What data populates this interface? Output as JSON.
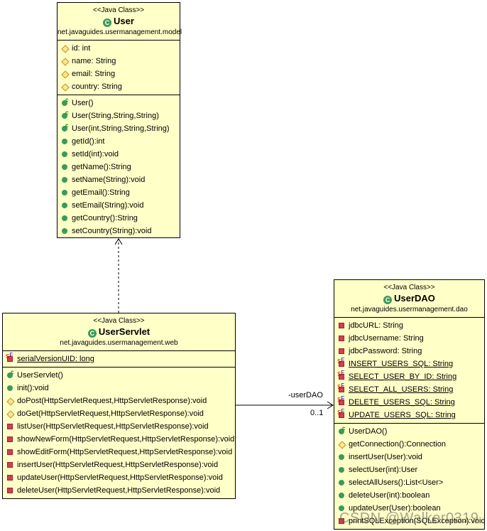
{
  "classes": {
    "user": {
      "stereotype": "<<Java Class>>",
      "name": "User",
      "package": "net.javaguides.usermanagement.model",
      "fields": [
        {
          "v": "protected",
          "t": "id: int"
        },
        {
          "v": "protected",
          "t": "name: String"
        },
        {
          "v": "protected",
          "t": "email: String"
        },
        {
          "v": "protected",
          "t": "country: String"
        }
      ],
      "methods": [
        {
          "v": "public",
          "c": true,
          "t": "User()"
        },
        {
          "v": "public",
          "c": true,
          "t": "User(String,String,String)"
        },
        {
          "v": "public",
          "c": true,
          "t": "User(int,String,String,String)"
        },
        {
          "v": "public",
          "t": "getId():int"
        },
        {
          "v": "public",
          "t": "setId(int):void"
        },
        {
          "v": "public",
          "t": "getName():String"
        },
        {
          "v": "public",
          "t": "setName(String):void"
        },
        {
          "v": "public",
          "t": "getEmail():String"
        },
        {
          "v": "public",
          "t": "setEmail(String):void"
        },
        {
          "v": "public",
          "t": "getCountry():String"
        },
        {
          "v": "public",
          "t": "setCountry(String):void"
        }
      ]
    },
    "servlet": {
      "stereotype": "<<Java Class>>",
      "name": "UserServlet",
      "package": "net.javaguides.usermanagement.web",
      "fields": [
        {
          "v": "private",
          "sf": true,
          "t": "serialVersionUID: long"
        }
      ],
      "methods": [
        {
          "v": "public",
          "c": true,
          "t": "UserServlet()"
        },
        {
          "v": "public",
          "t": "init():void"
        },
        {
          "v": "protected",
          "t": "doPost(HttpServletRequest,HttpServletResponse):void"
        },
        {
          "v": "protected",
          "t": "doGet(HttpServletRequest,HttpServletResponse):void"
        },
        {
          "v": "private",
          "t": "listUser(HttpServletRequest,HttpServletResponse):void"
        },
        {
          "v": "private",
          "t": "showNewForm(HttpServletRequest,HttpServletResponse):void"
        },
        {
          "v": "private",
          "t": "showEditForm(HttpServletRequest,HttpServletResponse):void"
        },
        {
          "v": "private",
          "t": "insertUser(HttpServletRequest,HttpServletResponse):void"
        },
        {
          "v": "private",
          "t": "updateUser(HttpServletRequest,HttpServletResponse):void"
        },
        {
          "v": "private",
          "t": "deleteUser(HttpServletRequest,HttpServletResponse):void"
        }
      ]
    },
    "dao": {
      "stereotype": "<<Java Class>>",
      "name": "UserDAO",
      "package": "net.javaguides.usermanagement.dao",
      "fields": [
        {
          "v": "private",
          "t": "jdbcURL: String"
        },
        {
          "v": "private",
          "t": "jdbcUsername: String"
        },
        {
          "v": "private",
          "t": "jdbcPassword: String"
        },
        {
          "v": "private",
          "sf": true,
          "t": "INSERT_USERS_SQL: String"
        },
        {
          "v": "private",
          "sf": true,
          "t": "SELECT_USER_BY_ID: String"
        },
        {
          "v": "private",
          "sf": true,
          "t": "SELECT_ALL_USERS: String"
        },
        {
          "v": "private",
          "sf": true,
          "t": "DELETE_USERS_SQL: String"
        },
        {
          "v": "private",
          "sf": true,
          "t": "UPDATE_USERS_SQL: String"
        }
      ],
      "methods": [
        {
          "v": "public",
          "c": true,
          "t": "UserDAO()"
        },
        {
          "v": "protected",
          "t": "getConnection():Connection"
        },
        {
          "v": "public",
          "t": "insertUser(User):void"
        },
        {
          "v": "public",
          "t": "selectUser(int):User"
        },
        {
          "v": "public",
          "t": "selectAllUsers():List<User>"
        },
        {
          "v": "public",
          "t": "deleteUser(int):boolean"
        },
        {
          "v": "public",
          "t": "updateUser(User):boolean"
        },
        {
          "v": "private",
          "t": "printSQLException(SQLException):void"
        }
      ]
    }
  },
  "association": {
    "role": "-userDAO",
    "multiplicity": "0..1"
  },
  "watermark": "CSDN @Walker0319"
}
